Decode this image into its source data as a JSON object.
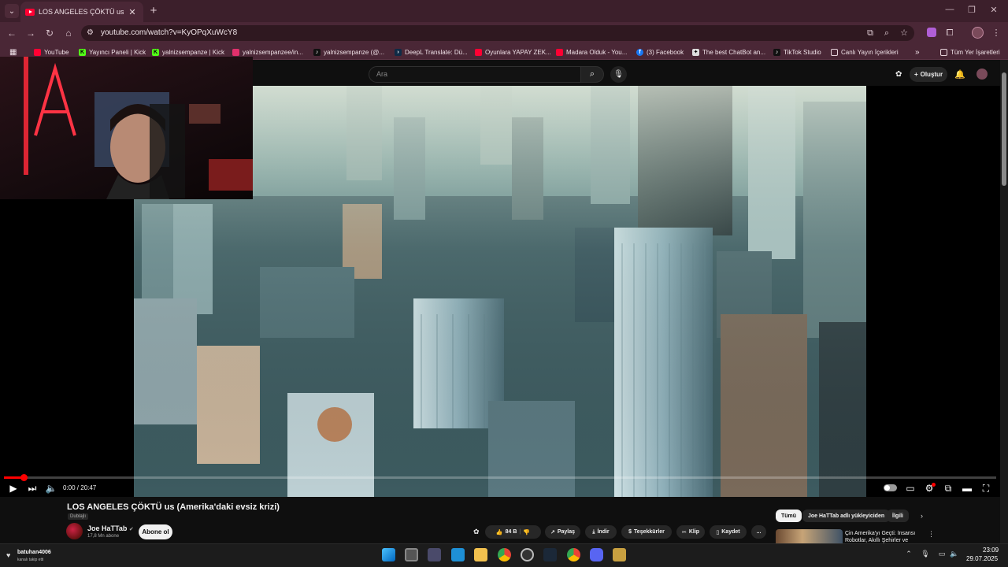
{
  "browser": {
    "tab_title": "LOS ANGELES ÇÖKTÜ us (Amerika'daki evsiz krizi)",
    "tab_close": "✕",
    "new_tab": "+",
    "url": "youtube.com/watch?v=KyOPqXuWcY8",
    "bookmarks": [
      {
        "label": "YouTube",
        "color": "#ff0033"
      },
      {
        "label": "Yayıncı Paneli | Kick",
        "color": "#53fc18"
      },
      {
        "label": "yalnizsempanze | Kick",
        "color": "#53fc18"
      },
      {
        "label": "yalnizsempanzee/in...",
        "color": "#e1306c"
      },
      {
        "label": "yalnizsempanze (@...",
        "color": "#111111"
      },
      {
        "label": "DeepL Translate: Dü...",
        "color": "#0f2b46"
      },
      {
        "label": "Oyunlara YAPAY ZEK...",
        "color": "#ff0033"
      },
      {
        "label": "Madara Olduk - You...",
        "color": "#ff0033"
      },
      {
        "label": "(3) Facebook",
        "color": "#1877f2"
      },
      {
        "label": "The best ChatBot an...",
        "color": "#dddddd"
      },
      {
        "label": "TikTok Studio",
        "color": "#111111"
      },
      {
        "label": "Canlı Yayın İçerikleri",
        "color": "#4a2736"
      }
    ],
    "bookmarks_overflow": "»",
    "all_bookmarks": "Tüm Yer İşaretleri"
  },
  "youtube": {
    "search_placeholder": "Ara",
    "create_label": "Oluştur",
    "player": {
      "time": "0:00 / 20:47",
      "progress": 0.02
    },
    "video_title": "LOS ANGELES ÇÖKTÜ us (Amerika'daki evsiz krizi)",
    "dub_badge": "Dublajlı",
    "channel": {
      "name": "Joe HaTTab",
      "subs": "17,8 Mn abone",
      "subscribe_label": "Abone ol"
    },
    "actions": {
      "likes": "84 B",
      "share": "Paylaş",
      "download": "İndir",
      "thanks": "Teşekkürler",
      "clip": "Klip",
      "save": "Kaydet",
      "more": "..."
    },
    "chips": [
      "Tümü",
      "Joe HaTTab adlı yükleyiciden",
      "İlgili"
    ],
    "recommendation_title": "Çin Amerika'yı Geçti: İnsansı Robotlar, Akıllı Şehirler ve Süp..."
  },
  "taskbar": {
    "user": "batuhan4006",
    "user_sub": "kanalı takip etti",
    "time": "23:09",
    "date": "29.07.2025"
  }
}
